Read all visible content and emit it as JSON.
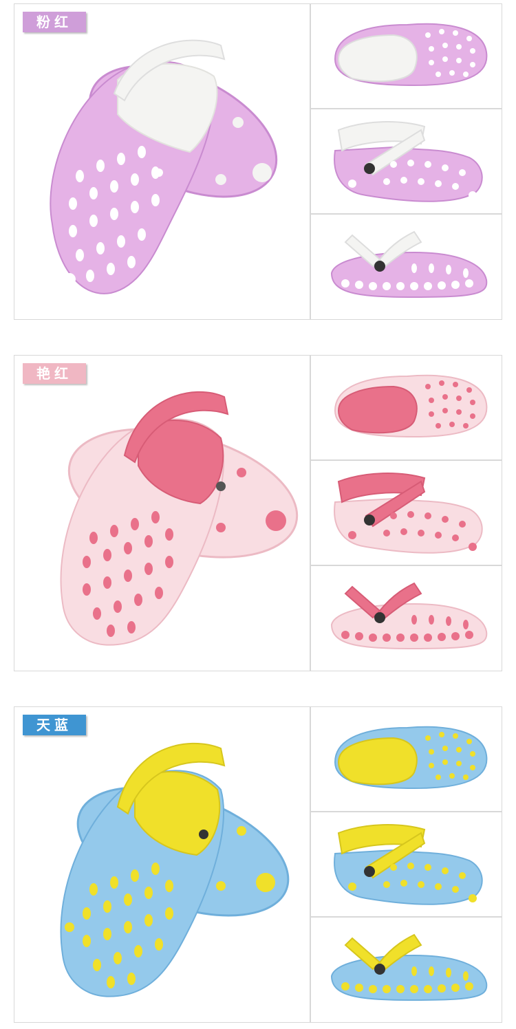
{
  "sections": [
    {
      "label": "粉红",
      "badge_color": "#cf9ed9",
      "body_color": "#e5b2e6",
      "body_dark": "#c98bd0",
      "lining_color": "#f4f4f2",
      "hole_color": "#ffffff"
    },
    {
      "label": "艳红",
      "badge_color": "#f0b7c3",
      "body_color": "#f9dde2",
      "body_dark": "#ecbac4",
      "lining_color": "#e9718a",
      "hole_color": "#e9718a"
    },
    {
      "label": "天蓝",
      "badge_color": "#3f95d2",
      "body_color": "#94c9eb",
      "body_dark": "#6fafdb",
      "lining_color": "#f0e02a",
      "hole_color": "#f0e02a"
    }
  ]
}
